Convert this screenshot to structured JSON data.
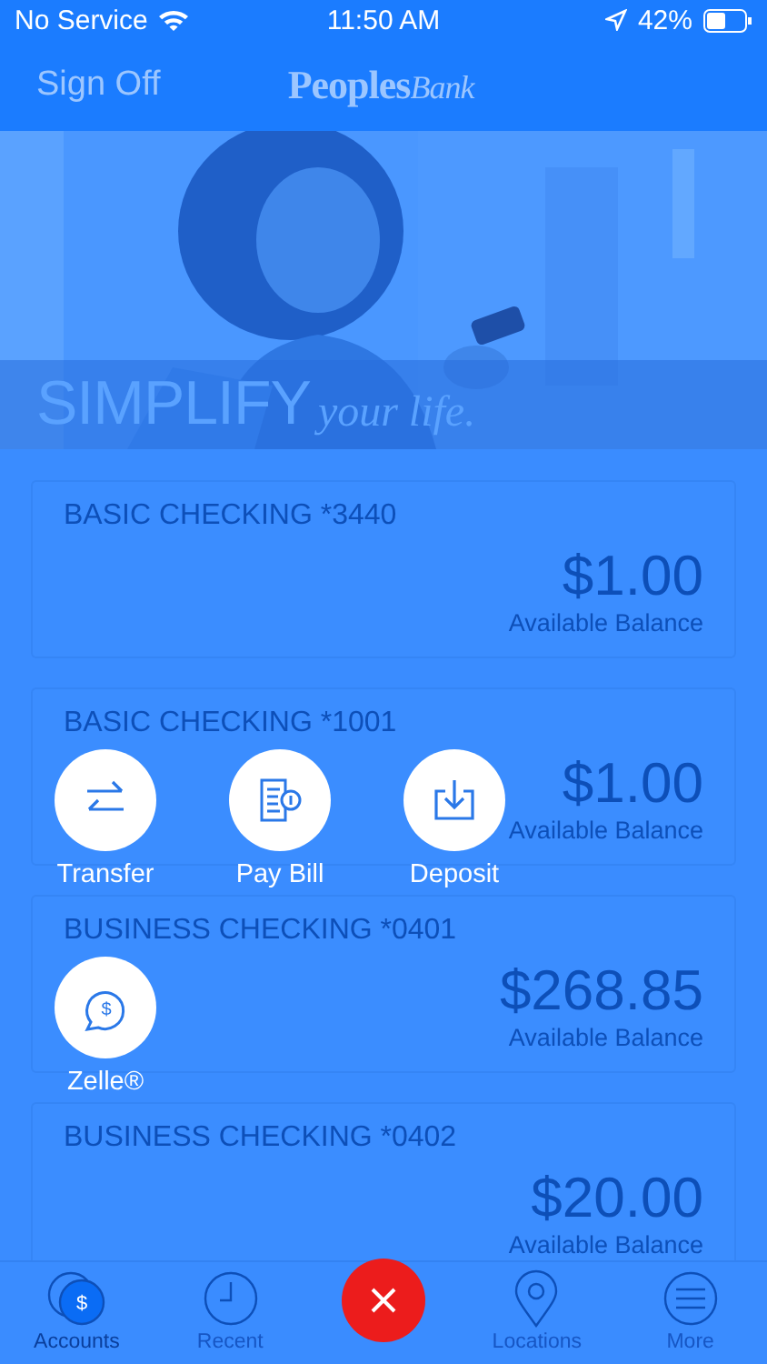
{
  "status_bar": {
    "carrier": "No Service",
    "time": "11:50 AM",
    "battery": "42%"
  },
  "header": {
    "sign_off": "Sign Off",
    "logo": {
      "bold": "Peoples",
      "script": "Bank"
    }
  },
  "banner": {
    "kind": "picture",
    "headline": "SIMPLIFY",
    "tagline": "your life."
  },
  "accounts": [
    {
      "name": "BASIC CHECKING *3440",
      "amount": "$1.00",
      "caption": "Available Balance"
    },
    {
      "name": "BASIC CHECKING *1001",
      "amount": "$1.00",
      "caption": "Available Balance"
    },
    {
      "name": "BUSINESS CHECKING *0401",
      "amount": "$268.85",
      "caption": "Available Balance"
    },
    {
      "name": "BUSINESS CHECKING *0402",
      "amount": "$20.00",
      "caption": "Available Balance"
    }
  ],
  "actions": [
    {
      "kind": "transfer",
      "label": "Transfer"
    },
    {
      "kind": "bill",
      "label": "Pay Bill"
    },
    {
      "kind": "deposit",
      "label": "Deposit"
    },
    {
      "kind": "zelle",
      "label": "Zelle®",
      "glyph": "$"
    }
  ],
  "tab_bar": [
    {
      "kind": "accounts",
      "label": "Accounts",
      "selected": true,
      "glyph": "$"
    },
    {
      "kind": "recent",
      "label": "Recent",
      "selected": false
    },
    {
      "kind": "close"
    },
    {
      "kind": "locations",
      "label": "Locations",
      "selected": false
    },
    {
      "kind": "more",
      "label": "More",
      "selected": false
    }
  ]
}
